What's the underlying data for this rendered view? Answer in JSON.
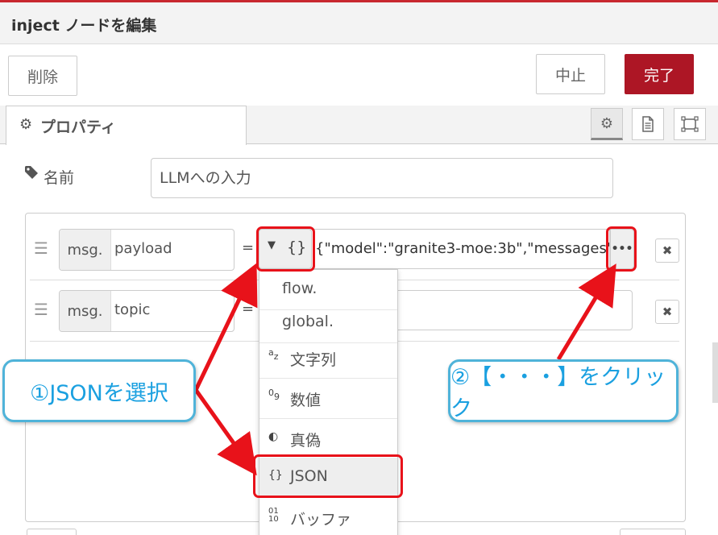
{
  "header": {
    "title": "inject ノードを編集"
  },
  "buttons": {
    "delete": "削除",
    "cancel": "中止",
    "done": "完了"
  },
  "tabs": {
    "properties": "プロパティ"
  },
  "fields": {
    "name_label": "名前",
    "name_value": "LLMへの入力"
  },
  "properties": [
    {
      "prefix": "msg.",
      "name": "payload",
      "equals": "=",
      "type_icon": "{}",
      "value": "{\"model\":\"granite3-moe:3b\",\"messages\"",
      "ellipsis": "•••"
    },
    {
      "prefix": "msg.",
      "name": "topic",
      "equals": "=",
      "value": ""
    }
  ],
  "type_menu": {
    "items": [
      {
        "label": "flow.",
        "icon": ""
      },
      {
        "label": "global.",
        "icon": ""
      },
      {
        "label": "文字列",
        "icon": "az"
      },
      {
        "label": "数値",
        "icon": "09"
      },
      {
        "label": "真偽",
        "icon": "◐"
      },
      {
        "label": "JSON",
        "icon": "{}"
      },
      {
        "label": "バッファ",
        "icon": "0110"
      }
    ],
    "selected": "JSON"
  },
  "annotations": {
    "callout_1": "①JSONを選択",
    "callout_2": "②【・・・】をクリック"
  },
  "colors": {
    "accent": "#c8282f",
    "done_button": "#ad1625",
    "highlight": "#e8121a",
    "callout_border": "#4fb3d9",
    "callout_text": "#1aa0e0"
  },
  "icons": {
    "properties_tab": "gear-icon",
    "description_tab": "document-icon",
    "appearance_tab": "frame-icon",
    "name": "tag-icon",
    "drag": "drag-handle-icon",
    "remove": "close-icon"
  }
}
